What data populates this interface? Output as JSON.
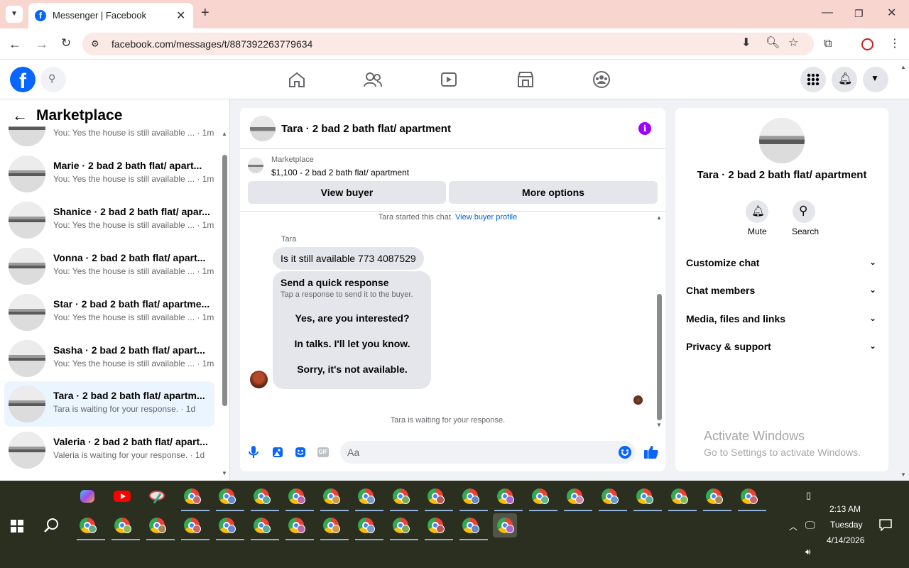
{
  "browser": {
    "tab_title": "Messenger | Facebook",
    "url": "facebook.com/messages/t/887392263779634"
  },
  "sidebar": {
    "title": "Marketplace",
    "conversations": [
      {
        "name": "",
        "preview": "You: Yes the house is still available ...",
        "time": "1m"
      },
      {
        "name": "Marie · 2 bad 2 bath flat/ apart...",
        "preview": "You: Yes the house is still available ...",
        "time": "1m"
      },
      {
        "name": "Shanice · 2 bad 2 bath flat/ apar...",
        "preview": "You: Yes the house is still available ...",
        "time": "1m"
      },
      {
        "name": "Vonna · 2 bad 2 bath flat/ apart...",
        "preview": "You: Yes the house is still available ...",
        "time": "1m"
      },
      {
        "name": "Star · 2 bad 2 bath flat/ apartme...",
        "preview": "You: Yes the house is still available ...",
        "time": "1m"
      },
      {
        "name": "Sasha · 2 bad 2 bath flat/ apart...",
        "preview": "You: Yes the house is still available ...",
        "time": "1m"
      },
      {
        "name": "Tara · 2 bad 2 bath flat/ apartm...",
        "preview": "Tara is waiting for your response.",
        "time": "1d"
      },
      {
        "name": "Valeria · 2 bad 2 bath flat/ apart...",
        "preview": "Valeria is waiting for your response.",
        "time": "1d"
      }
    ]
  },
  "chat": {
    "header_title": "Tara · 2 bad 2 bath flat/ apartment",
    "listing_source": "Marketplace",
    "listing_title": "$1,100 - 2 bad 2 bath flat/ apartment",
    "view_buyer": "View buyer",
    "more_options": "More options",
    "started_text": "Tara started this chat.",
    "view_buyer_profile": "View buyer profile",
    "sender_name": "Tara",
    "message": "Is it still available 773 4087529",
    "quick_title": "Send a quick response",
    "quick_sub": "Tap a response to send it to the buyer.",
    "quick_options": [
      "Yes, are you interested?",
      "In talks. I'll let you know.",
      "Sorry, it's not available."
    ],
    "waiting": "Tara is waiting for your response.",
    "input_placeholder": "Aa"
  },
  "details": {
    "name": "Tara · 2 bad 2 bath flat/ apartment",
    "mute": "Mute",
    "search": "Search",
    "sections": [
      "Customize chat",
      "Chat members",
      "Media, files and links",
      "Privacy & support"
    ],
    "watermark_title": "Activate Windows",
    "watermark_sub": "Go to Settings to activate Windows."
  },
  "taskbar": {
    "time": "2:13 AM",
    "day": "Tuesday",
    "date": "4/14/2026"
  },
  "colors": {
    "fb_blue": "#0866ff",
    "purple_info": "#a100ff",
    "tab_bar": "#f9d5cf"
  }
}
